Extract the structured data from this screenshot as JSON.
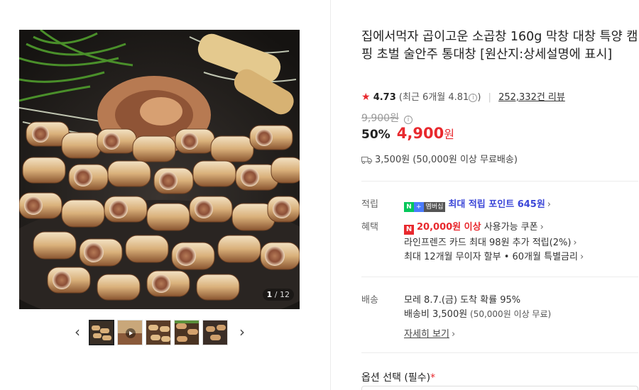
{
  "gallery": {
    "counter_current": "1",
    "counter_total": "/ 12",
    "prev_arrow": "‹",
    "next_arrow": "›"
  },
  "product": {
    "title": "집에서먹자 곱이고운 소곱창 160g 막창 대창 특양 캠핑 초벌 술안주 통대창 [원산지:상세설명에 표시]",
    "rating": {
      "star": "★",
      "score": "4.73",
      "recent": "(최근 6개월 4.81",
      "recent_close": ")",
      "reviews": "252,332건 리뷰"
    },
    "original_price": "9,900원",
    "discount_rate": "50%",
    "sale_price": "4,900",
    "sale_unit": "원",
    "shipping_summary": "3,500원 (50,000원 이상 무료배송)"
  },
  "benefits": {
    "points_label": "적립",
    "badge_n": "N",
    "badge_plus": "+",
    "badge_member": "멤버십",
    "points_text": "최대 적립 포인트 645원",
    "perks_label": "혜택",
    "coupon_logo": "N",
    "coupon_amount": "20,000원 이상",
    "coupon_text": " 사용가능 쿠폰",
    "card_text": "라인프렌즈 카드 최대 98원 추가 적립(2%)",
    "installment_text": "최대 12개월 무이자 할부 • 60개월 특별금리",
    "chevron": "›"
  },
  "delivery": {
    "label": "배송",
    "eta": "모레 8.7.(금) 도착 확률 95%",
    "fee_prefix": "배송비 3,500원",
    "fee_note": " (50,000원 이상 무료)",
    "detail_link": "자세히 보기"
  },
  "options": {
    "title": "옵션 선택 (필수)",
    "required_mark": "*"
  },
  "colors": {
    "accent_red": "#e8292e",
    "point_blue": "#3c47d8",
    "naver_green": "#03c75a"
  }
}
